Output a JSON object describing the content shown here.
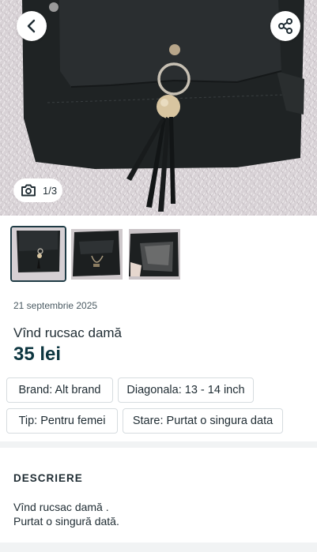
{
  "header": {
    "back_icon": "chevron-left-icon",
    "share_icon": "share-icon"
  },
  "gallery": {
    "counter": "1/3",
    "camera_icon": "camera-icon"
  },
  "listing": {
    "date": "21 septembrie 2025",
    "title": "Vînd rucsac damă",
    "price": "35 lei"
  },
  "attributes": [
    "Brand: Alt brand",
    "Diagonala: 13 - 14 inch",
    "Tip: Pentru femei",
    "Stare: Purtat o singura data"
  ],
  "description": {
    "heading": "DESCRIERE",
    "lines": [
      "Vînd rucsac damă .",
      "Purtat o singură dată."
    ]
  },
  "colors": {
    "accent": "#0d3640",
    "chip_border": "#d6dcdf",
    "separator": "#f1f3f4"
  }
}
